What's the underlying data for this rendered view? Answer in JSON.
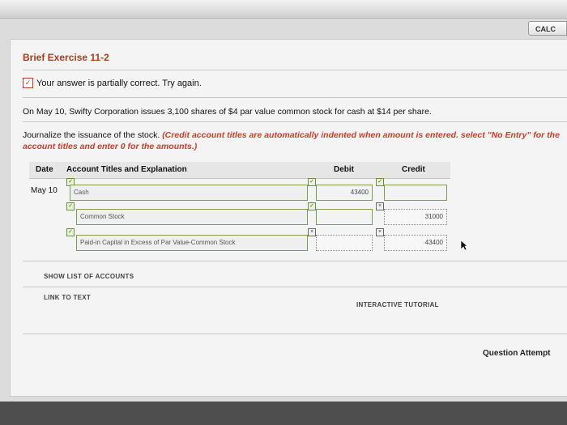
{
  "toolbar": {
    "calc_label": "CALC"
  },
  "exercise": {
    "title": "Brief Exercise 11-2",
    "status": "Your answer is partially correct.  Try again.",
    "question": "On May 10, Swifty Corporation issues 3,100 shares of $4 par value common stock for cash at $14 per share.",
    "instruction_plain": "Journalize the issuance of the stock.",
    "instruction_red": "(Credit account titles are automatically indented when amount is entered. select \"No Entry\" for the account titles and enter 0 for the amounts.)"
  },
  "journal": {
    "headers": {
      "date": "Date",
      "account": "Account Titles and Explanation",
      "debit": "Debit",
      "credit": "Credit"
    },
    "date": "May 10",
    "rows": [
      {
        "account": "Cash",
        "debit": "43400",
        "credit": ""
      },
      {
        "account": "Common Stock",
        "debit": "",
        "credit": "31000"
      },
      {
        "account": "Paid-in Capital in Excess of Par Value-Common Stock",
        "debit": "",
        "credit": "43400"
      }
    ]
  },
  "links": {
    "show_list": "SHOW LIST OF ACCOUNTS",
    "link_to_text": "LINK TO TEXT",
    "tutorial": "INTERACTIVE TUTORIAL"
  },
  "footer": {
    "question_attempts": "Question Attempt"
  },
  "colors": {
    "title": "#b23a1d",
    "error_red": "#d23b2b",
    "field_border": "#7c9d4f"
  },
  "icons": [
    "partial-answer-icon",
    "check-icon",
    "x-icon",
    "cursor-icon"
  ]
}
